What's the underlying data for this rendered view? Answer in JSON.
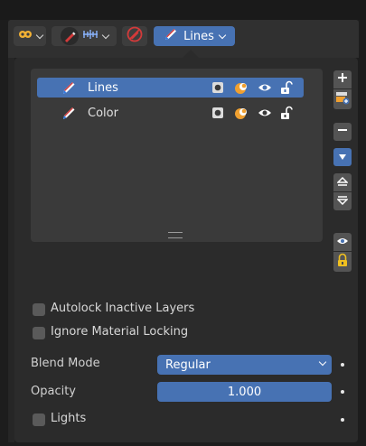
{
  "header": {
    "active_layer_label": "Lines"
  },
  "layers": {
    "items": [
      {
        "name": "Lines",
        "active": true
      },
      {
        "name": "Color",
        "active": false
      }
    ]
  },
  "options": {
    "autolock_label": "Autolock Inactive Layers",
    "ignore_material_label": "Ignore Material Locking",
    "blend_mode_label": "Blend Mode",
    "blend_mode_value": "Regular",
    "opacity_label": "Opacity",
    "opacity_value": "1.000",
    "lights_label": "Lights"
  },
  "colors": {
    "accent": "#4772b3",
    "panel": "#2b2b2b",
    "list_bg": "#3a3a3a",
    "pencil_blue": "#2f7ae5",
    "pencil_red": "#d33a3a",
    "onion_orange": "#f0a030"
  },
  "icons": [
    "overlay-icon",
    "gpencil-edit-icon",
    "ruler-icon",
    "gpencil-disabled-icon",
    "pencil-icon",
    "mask-icon",
    "onion-skin-icon",
    "eye-icon",
    "lock-icon",
    "add-icon",
    "add-layer-icon",
    "remove-icon",
    "menu-down-icon",
    "move-up-icon",
    "move-down-icon"
  ]
}
